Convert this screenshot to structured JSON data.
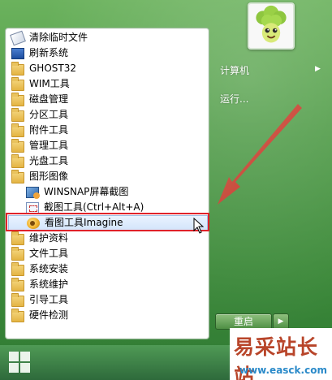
{
  "menu": {
    "items": [
      {
        "label": "清除临时文件",
        "icon": "eraser-icon"
      },
      {
        "label": "刷新系统",
        "icon": "refresh-icon"
      },
      {
        "label": "GHOST32",
        "icon": "folder-icon"
      },
      {
        "label": "WIM工具",
        "icon": "folder-icon"
      },
      {
        "label": "磁盘管理",
        "icon": "folder-icon"
      },
      {
        "label": "分区工具",
        "icon": "folder-icon"
      },
      {
        "label": "附件工具",
        "icon": "folder-icon"
      },
      {
        "label": "管理工具",
        "icon": "folder-icon"
      },
      {
        "label": "光盘工具",
        "icon": "folder-icon"
      },
      {
        "label": "图形图像",
        "icon": "folder-icon"
      },
      {
        "label": "WINSNAP屏幕截图",
        "icon": "winsnap-icon"
      },
      {
        "label": "截图工具(Ctrl+Alt+A)",
        "icon": "snipping-tool-icon"
      },
      {
        "label": "看图工具Imagine",
        "icon": "imagine-icon"
      },
      {
        "label": "维护资料",
        "icon": "folder-icon"
      },
      {
        "label": "文件工具",
        "icon": "folder-icon"
      },
      {
        "label": "系统安装",
        "icon": "folder-icon"
      },
      {
        "label": "系统维护",
        "icon": "folder-icon"
      },
      {
        "label": "引导工具",
        "icon": "folder-icon"
      },
      {
        "label": "硬件检测",
        "icon": "folder-icon"
      }
    ]
  },
  "right": {
    "computer_label": "计算机",
    "run_label": "运行..."
  },
  "power": {
    "restart_label": "重启"
  },
  "watermark": {
    "title": "易采站长站",
    "url": "www.easck.com"
  },
  "colors": {
    "accent_green": "#4f9b47",
    "highlight_red": "#e0222a",
    "watermark_red": "#b8452a",
    "watermark_blue": "#2a8ac9"
  }
}
